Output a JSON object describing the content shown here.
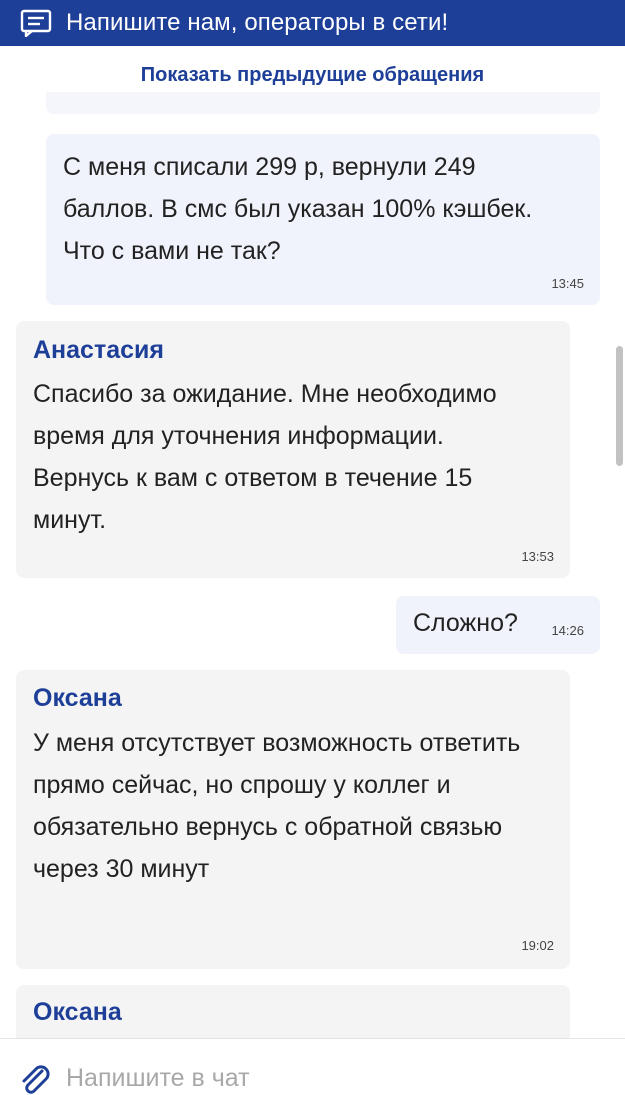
{
  "header": {
    "title": "Напишите нам, операторы в сети!",
    "icon": "chat-icon"
  },
  "previous_link": "Показать предыдущие обращения",
  "messages": [
    {
      "type": "user",
      "text": "С меня списали 299 р, вернули 249 баллов. В смс был указан 100% кэшбек. Что с вами не так?",
      "time": "13:45"
    },
    {
      "type": "operator",
      "author": "Анастасия",
      "text": "Спасибо за ожидание. Мне необходимо время для уточнения информации. Вернусь к вам с ответом в течение 15 минут.",
      "time": "13:53"
    },
    {
      "type": "user",
      "text": "Сложно?",
      "time": "14:26"
    },
    {
      "type": "operator",
      "author": "Оксана",
      "text": "У меня отсутствует возможность ответить прямо сейчас, но спрошу у коллег и обязательно вернусь с обратной связью через 30 минут",
      "time": "19:02"
    },
    {
      "type": "operator",
      "author": "Оксана",
      "text": "",
      "time": ""
    }
  ],
  "input": {
    "placeholder": "Напишите в чат",
    "attach_icon": "paperclip-icon"
  },
  "colors": {
    "brand": "#1e3f98",
    "user_bubble": "#f0f3fb",
    "operator_bubble": "#f4f4f5"
  }
}
